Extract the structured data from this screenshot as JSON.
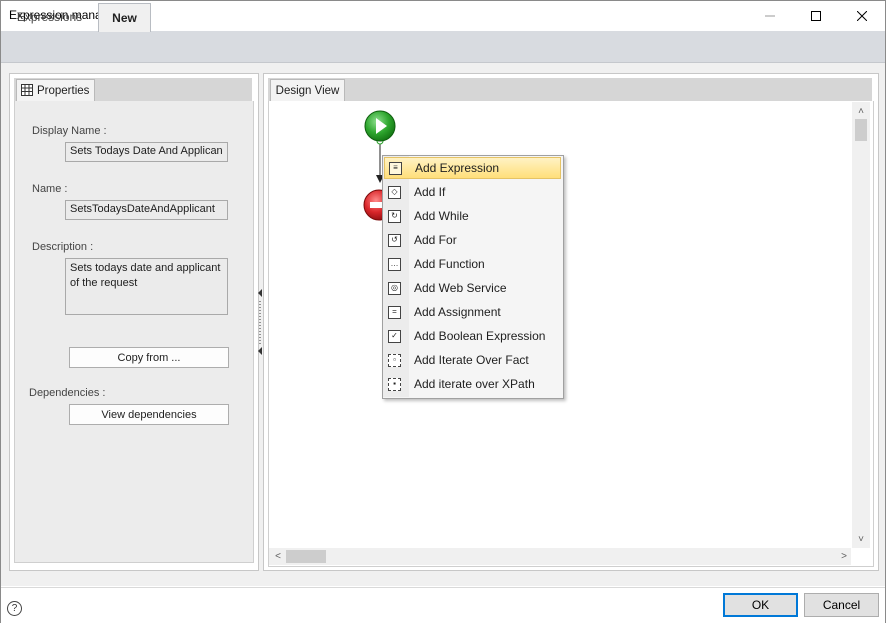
{
  "window": {
    "title": "Expression manager",
    "minimize_icon": "minimize-icon",
    "maximize_icon": "maximize-icon",
    "close_icon": "close-icon"
  },
  "tabs": [
    {
      "label": "Expressions",
      "active": false
    },
    {
      "label": "New",
      "active": true
    }
  ],
  "properties": {
    "tab_label": "Properties",
    "tab_icon": "properties-grid-icon",
    "display_name_label": "Display Name :",
    "display_name_value": "Sets Todays Date And Applican",
    "name_label": "Name :",
    "name_value": "SetsTodaysDateAndApplicant",
    "description_label": "Description :",
    "description_value": "Sets todays date and applicant of the request",
    "copy_from_button": "Copy from ...",
    "dependencies_label": "Dependencies :",
    "view_dependencies_button": "View dependencies"
  },
  "design_view": {
    "tab_label": "Design View",
    "start_node_icon": "play-start-icon",
    "end_node_icon": "stop-end-icon"
  },
  "context_menu": {
    "items": [
      {
        "label": "Add Expression",
        "icon": "expression-icon",
        "highlighted": true
      },
      {
        "label": "Add If",
        "icon": "if-icon",
        "highlighted": false
      },
      {
        "label": "Add While",
        "icon": "while-loop-icon",
        "highlighted": false
      },
      {
        "label": "Add For",
        "icon": "for-loop-icon",
        "highlighted": false
      },
      {
        "label": "Add Function",
        "icon": "function-icon",
        "highlighted": false
      },
      {
        "label": "Add Web Service",
        "icon": "web-service-icon",
        "highlighted": false
      },
      {
        "label": "Add Assignment",
        "icon": "assignment-icon",
        "highlighted": false
      },
      {
        "label": "Add Boolean Expression",
        "icon": "boolean-check-icon",
        "highlighted": false
      },
      {
        "label": "Add Iterate Over Fact",
        "icon": "iterate-fact-icon",
        "highlighted": false
      },
      {
        "label": "Add iterate over XPath",
        "icon": "iterate-xpath-icon",
        "highlighted": false
      }
    ]
  },
  "footer": {
    "help_icon": "help-icon",
    "ok_button": "OK",
    "cancel_button": "Cancel"
  },
  "colors": {
    "accent": "#0078d7",
    "highlight": "#ffdf7a",
    "start_green": "#2ea62e",
    "stop_red": "#d9262a"
  }
}
